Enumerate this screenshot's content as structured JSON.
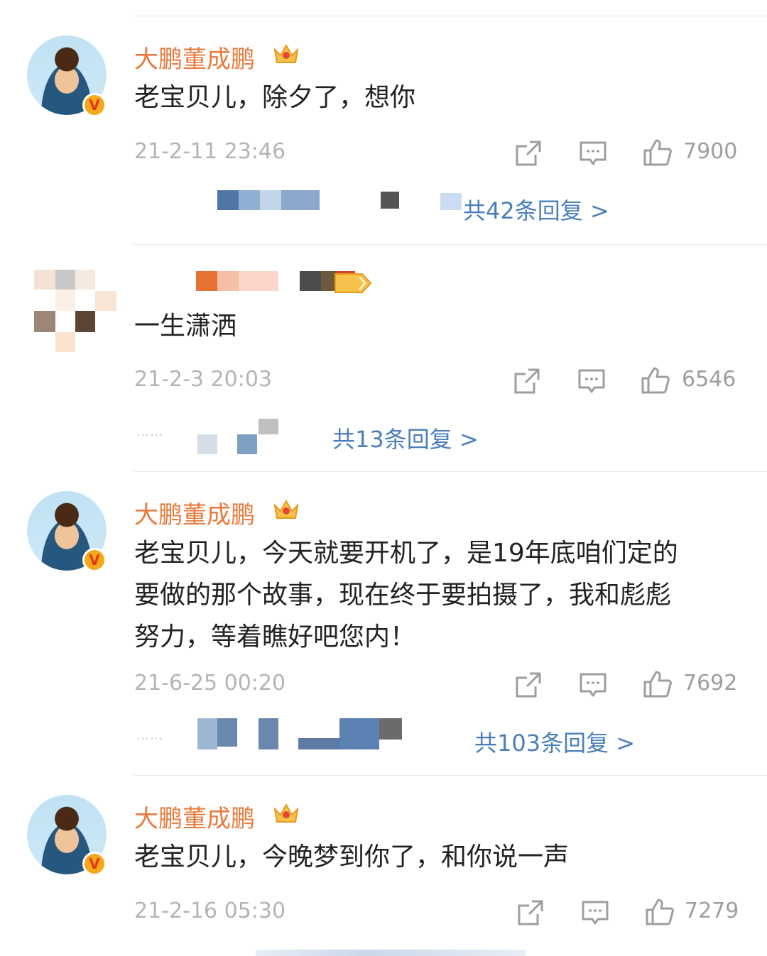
{
  "comments": [
    {
      "username": "大鹏董成鹏",
      "verified_badge": "V",
      "text": "老宝贝儿，除夕了，想你",
      "time": "21-2-11 23:46",
      "likes": "7900",
      "reply_summary": "共42条回复 >"
    },
    {
      "username": "",
      "text": "一生潇洒",
      "time": "21-2-3 20:03",
      "likes": "6546",
      "reply_summary": "共13条回复 >"
    },
    {
      "username": "大鹏董成鹏",
      "verified_badge": "V",
      "text_lines": [
        "老宝贝儿，今天就要开机了，是19年底咱们定的",
        "要做的那个故事，现在终于要拍摄了，我和彪彪",
        "努力，等着瞧好吧您内！"
      ],
      "time": "21-6-25 00:20",
      "likes": "7692",
      "reply_summary": "共103条回复 >"
    },
    {
      "username": "大鹏董成鹏",
      "verified_badge": "V",
      "text": "老宝贝儿，今晚梦到你了，和你说一声",
      "time": "21-2-16 05:30",
      "likes": "7279"
    }
  ],
  "icons": {
    "share": "share-icon",
    "comment": "comment-icon",
    "like": "thumbs-up-icon",
    "crown": "crown-icon",
    "verified": "verified-badge-icon"
  },
  "colors": {
    "username": "#e87a3c",
    "reply_link": "#4a7fbd",
    "meta": "#b4b4b4",
    "verified_badge": "#f4a81c"
  }
}
